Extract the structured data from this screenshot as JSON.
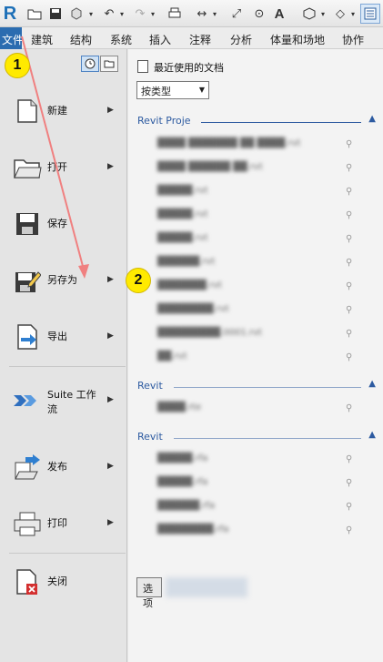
{
  "toolbar": {
    "logo_letter": "R",
    "text_tool_letter": "A"
  },
  "ribbon": {
    "tabs": [
      "文件",
      "建筑",
      "结构",
      "系统",
      "插入",
      "注释",
      "分析",
      "体量和场地",
      "协作"
    ]
  },
  "menu": {
    "items": [
      {
        "label": "新建",
        "has_submenu": true
      },
      {
        "label": "打开",
        "has_submenu": true
      },
      {
        "label": "保存",
        "has_submenu": false
      },
      {
        "label": "另存为",
        "has_submenu": true
      },
      {
        "label": "导出",
        "has_submenu": true
      },
      {
        "label": "Suite 工作",
        "label2": "流",
        "has_submenu": true
      },
      {
        "label": "发布",
        "has_submenu": true
      },
      {
        "label": "打印",
        "has_submenu": true
      },
      {
        "label": "关闭",
        "has_submenu": false
      }
    ]
  },
  "recent": {
    "title": "最近使用的文档",
    "sort_value": "按类型",
    "groups": [
      {
        "header": "Revit Proje",
        "docs": 10
      },
      {
        "header": "Revit",
        "docs": 1
      },
      {
        "header": "Revit",
        "docs": 4
      }
    ],
    "bottom_button": "选项"
  },
  "annotations": {
    "step1": "1",
    "step2": "2",
    "arrow_color": "#f08080",
    "badge_color": "#ffea00"
  }
}
